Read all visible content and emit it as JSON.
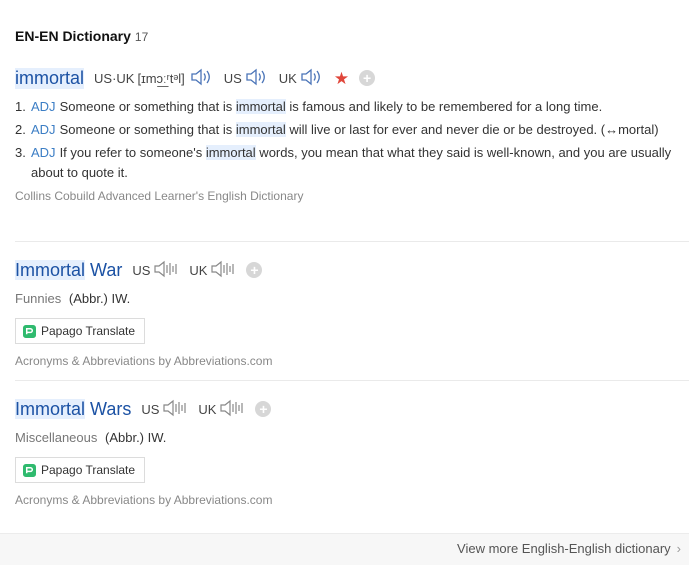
{
  "header": {
    "title": "EN-EN Dictionary",
    "count": "17"
  },
  "entries": [
    {
      "headword": "immortal",
      "pron_us_uk_label": "US·UK",
      "ipa": "[ɪmɔ͟ːʳtᵊl]",
      "us_label": "US",
      "uk_label": "UK",
      "definitions": [
        {
          "num": "1.",
          "pos": "ADJ",
          "pre": "Someone or something that is ",
          "hl": "immortal",
          "post": " is famous and likely to be remembered for a long time."
        },
        {
          "num": "2.",
          "pos": "ADJ",
          "pre": "Someone or something that is ",
          "hl": "immortal",
          "post": " will live or last for ever and never die or be destroyed. (↔mortal)"
        },
        {
          "num": "3.",
          "pos": "ADJ",
          "pre": "If you refer to someone's ",
          "hl": "immortal",
          "post": " words, you mean that what they said is well-known, and you are usually about to quote it."
        }
      ],
      "source": "Collins Cobuild Advanced Learner's English Dictionary"
    },
    {
      "headword_hl": "Immortal",
      "headword_rest": " War",
      "us_label": "US",
      "uk_label": "UK",
      "category": "Funnies",
      "meaning": "(Abbr.) IW.",
      "translate_label": "Papago Translate",
      "source": "Acronyms & Abbreviations by Abbreviations.com"
    },
    {
      "headword_hl": "Immortal",
      "headword_rest": " Wars",
      "us_label": "US",
      "uk_label": "UK",
      "category": "Miscellaneous",
      "meaning": "(Abbr.) IW.",
      "translate_label": "Papago Translate",
      "source": "Acronyms & Abbreviations by Abbreviations.com"
    }
  ],
  "footer": {
    "more_label": "View more English-English dictionary"
  },
  "colors": {
    "headword": "#1c52a4",
    "pos": "#3c7ec5",
    "star": "#e0463a",
    "highlight": "#e5effd"
  }
}
